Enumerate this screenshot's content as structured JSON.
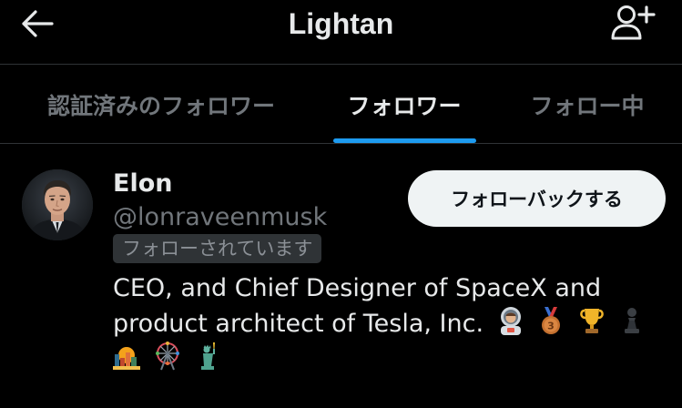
{
  "header": {
    "title": "Lightan",
    "back_icon": "arrow-left-icon",
    "add_user_icon": "person-add-icon"
  },
  "tabs": [
    {
      "label": "認証済みのフォロワー",
      "active": false
    },
    {
      "label": "フォロワー",
      "active": true
    },
    {
      "label": "フォロー中",
      "active": false
    }
  ],
  "user": {
    "display_name": "Elon",
    "handle": "@lonraveenmusk",
    "follows_you_label": "フォローされています",
    "follow_back_label": "フォローバックする",
    "bio": "CEO, and Chief Designer of SpaceX and product architect of Tesla, Inc.",
    "bio_emojis_line1": [
      "astronaut",
      "bronze-medal",
      "trophy",
      "chess-pawn"
    ],
    "bio_emojis_line2": [
      "sunrise-over-city",
      "ferris-wheel",
      "statue-of-liberty"
    ]
  },
  "colors": {
    "background": "#000000",
    "text_primary": "#e7e9ea",
    "text_secondary": "#71767b",
    "accent": "#1d9bf0",
    "divider": "#2f3336",
    "button_bg": "#eff3f4"
  }
}
